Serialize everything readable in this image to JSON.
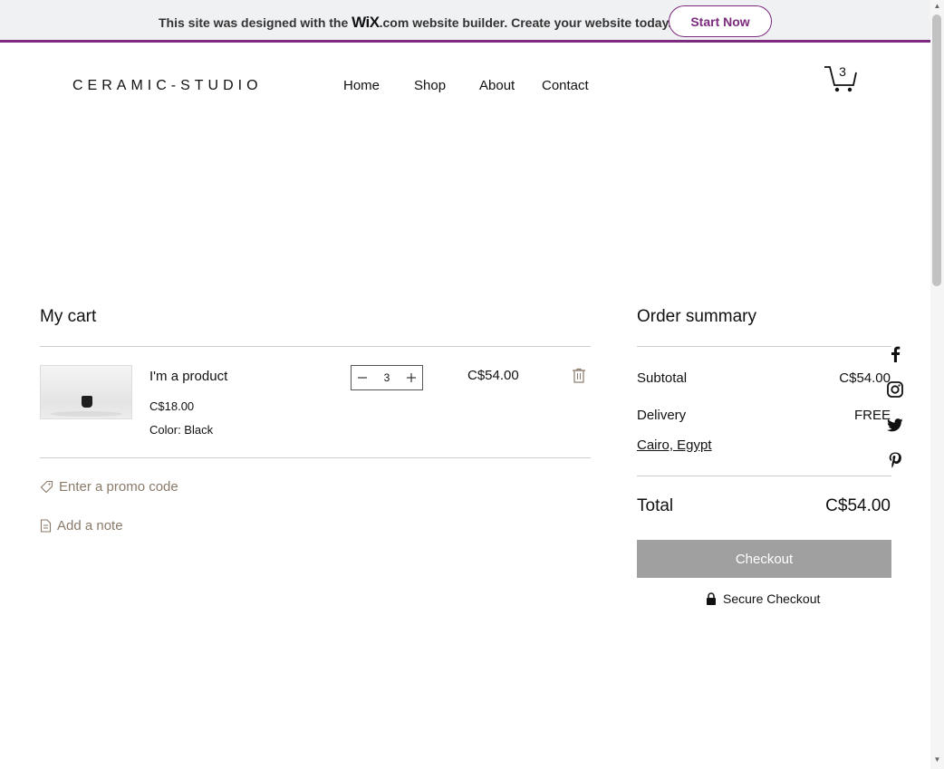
{
  "banner": {
    "text_before": "This site was designed with the",
    "wix_logo": "WiX",
    "text_after": ".com website builder. Create your website today.",
    "start_label": "Start Now",
    "accent_color": "#7b2a7e"
  },
  "header": {
    "logo": "CERAMIC-STUDIO",
    "nav": [
      "Home",
      "Shop",
      "About",
      "Contact"
    ],
    "cart_count": "3",
    "cart_icon": "shopping-cart-icon"
  },
  "cart": {
    "title": "My cart",
    "item": {
      "name": "I'm a product",
      "unit_price": "C$18.00",
      "color": "Color: Black",
      "quantity": "3",
      "line_total": "C$54.00"
    },
    "promo_label": "Enter a promo code",
    "note_label": "Add a note"
  },
  "summary": {
    "title": "Order summary",
    "subtotal_label": "Subtotal",
    "subtotal_value": "C$54.00",
    "delivery_label": "Delivery",
    "delivery_value": "FREE",
    "location": "Cairo, Egypt",
    "total_label": "Total",
    "total_value": "C$54.00",
    "checkout_label": "Checkout",
    "secure_label": "Secure Checkout"
  },
  "social": [
    "facebook-icon",
    "instagram-icon",
    "twitter-icon",
    "pinterest-icon"
  ]
}
